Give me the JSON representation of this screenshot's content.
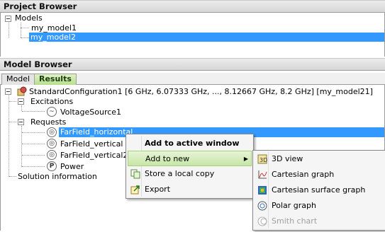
{
  "project_browser": {
    "title": "Project Browser",
    "root_label": "Models",
    "models": [
      "my_model1",
      "my_model2"
    ]
  },
  "model_browser": {
    "title": "Model Browser",
    "tabs": [
      "Model",
      "Results"
    ],
    "config_label": "StandardConfiguration1 [6 GHz, 6.07333 GHz, ..., 8.12667 GHz, 8.2 GHz] [my_model21]",
    "excitations_label": "Excitations",
    "voltage_source_label": "VoltageSource1",
    "requests_label": "Requests",
    "requests": [
      "FarField_horizontal",
      "FarField_vertical",
      "FarField_vertical2",
      "Power"
    ],
    "solution_info_label": "Solution information"
  },
  "context_menu": {
    "add_active": "Add to active window",
    "add_new": "Add to new",
    "store_copy": "Store a local copy",
    "export": "Export"
  },
  "submenu": {
    "items": [
      "3D view",
      "Cartesian graph",
      "Cartesian surface graph",
      "Polar graph",
      "Smith chart"
    ]
  },
  "colors": {
    "selection": "#3399ff",
    "tab_active": "#b8de8e",
    "menu_highlight": "#c7e6a6"
  }
}
